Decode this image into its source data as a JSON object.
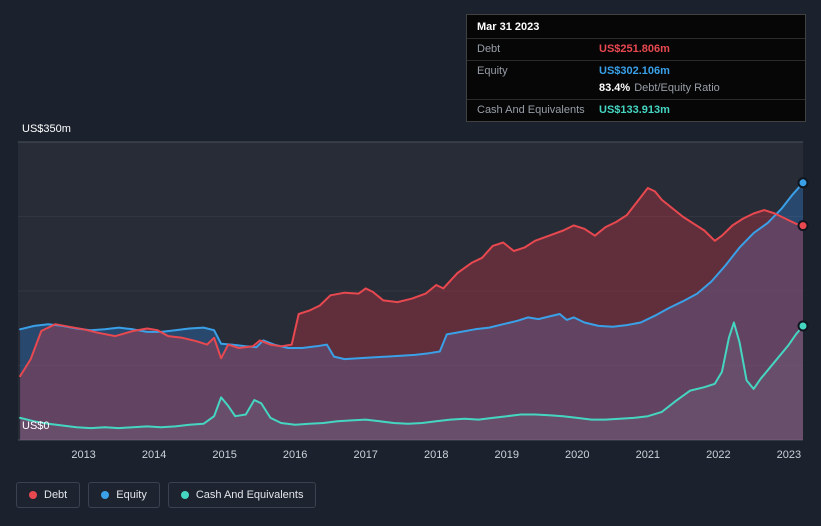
{
  "page": {
    "background": "#1b222d",
    "plot_background": "#272c36"
  },
  "y_axis": {
    "top_label": "US$350m",
    "bottom_label": "US$0"
  },
  "tooltip": {
    "date": "Mar 31 2023",
    "rows": [
      {
        "label": "Debt",
        "value": "US$251.806m",
        "color": "#e8484f"
      },
      {
        "label": "Equity",
        "value": "US$302.106m",
        "color": "#3aa0e8"
      },
      {
        "label": "Cash And Equivalents",
        "value": "US$133.913m",
        "color": "#45d6c2"
      }
    ],
    "ratio": {
      "value": "83.4%",
      "label": "Debt/Equity Ratio"
    }
  },
  "legend": {
    "items": [
      {
        "label": "Debt",
        "color": "#e8484f"
      },
      {
        "label": "Equity",
        "color": "#3aa0e8"
      },
      {
        "label": "Cash And Equivalents",
        "color": "#45d6c2"
      }
    ]
  },
  "chart_data": {
    "type": "area",
    "title": "Debt, Equity and Cash And Equivalents history (US$m)",
    "ylim": [
      0,
      350
    ],
    "x_range": [
      2012.07,
      2023.2
    ],
    "x_ticks": [
      2013,
      2014,
      2015,
      2016,
      2017,
      2018,
      2019,
      2020,
      2021,
      2022,
      2023
    ],
    "gridlines": [
      0,
      87.5,
      175,
      262.5,
      350
    ],
    "grid": "horizontal-only",
    "legend_position": "bottom-left",
    "series": [
      {
        "name": "Equity",
        "color": "#3aa0e8",
        "fill": "rgba(42,120,200,0.38)",
        "points": [
          [
            2012.1,
            130
          ],
          [
            2012.3,
            134
          ],
          [
            2012.5,
            136
          ],
          [
            2012.7,
            134
          ],
          [
            2012.9,
            131
          ],
          [
            2013.1,
            129
          ],
          [
            2013.3,
            130
          ],
          [
            2013.5,
            132
          ],
          [
            2013.7,
            130
          ],
          [
            2013.9,
            127
          ],
          [
            2014.1,
            127
          ],
          [
            2014.3,
            129
          ],
          [
            2014.5,
            131
          ],
          [
            2014.7,
            132
          ],
          [
            2014.85,
            129
          ],
          [
            2014.95,
            113
          ],
          [
            2015.1,
            112
          ],
          [
            2015.3,
            110
          ],
          [
            2015.45,
            109
          ],
          [
            2015.55,
            117
          ],
          [
            2015.7,
            112
          ],
          [
            2015.9,
            108
          ],
          [
            2016.1,
            108
          ],
          [
            2016.3,
            110
          ],
          [
            2016.45,
            112
          ],
          [
            2016.55,
            98
          ],
          [
            2016.7,
            95
          ],
          [
            2016.9,
            96
          ],
          [
            2017.1,
            97
          ],
          [
            2017.3,
            98
          ],
          [
            2017.5,
            99
          ],
          [
            2017.7,
            100
          ],
          [
            2017.9,
            102
          ],
          [
            2018.05,
            104
          ],
          [
            2018.15,
            124
          ],
          [
            2018.35,
            127
          ],
          [
            2018.55,
            130
          ],
          [
            2018.75,
            132
          ],
          [
            2018.95,
            136
          ],
          [
            2019.15,
            140
          ],
          [
            2019.3,
            144
          ],
          [
            2019.45,
            142
          ],
          [
            2019.6,
            145
          ],
          [
            2019.75,
            148
          ],
          [
            2019.85,
            141
          ],
          [
            2019.95,
            144
          ],
          [
            2020.1,
            138
          ],
          [
            2020.3,
            134
          ],
          [
            2020.5,
            133
          ],
          [
            2020.7,
            135
          ],
          [
            2020.9,
            138
          ],
          [
            2021.1,
            146
          ],
          [
            2021.3,
            155
          ],
          [
            2021.5,
            163
          ],
          [
            2021.7,
            172
          ],
          [
            2021.9,
            186
          ],
          [
            2022.1,
            205
          ],
          [
            2022.3,
            226
          ],
          [
            2022.5,
            243
          ],
          [
            2022.7,
            255
          ],
          [
            2022.9,
            272
          ],
          [
            2023.05,
            288
          ],
          [
            2023.2,
            302.1
          ]
        ]
      },
      {
        "name": "Debt",
        "color": "#e8484f",
        "fill": "rgba(222,55,70,0.32)",
        "points": [
          [
            2012.1,
            75
          ],
          [
            2012.25,
            95
          ],
          [
            2012.4,
            128
          ],
          [
            2012.6,
            136
          ],
          [
            2012.8,
            133
          ],
          [
            2013.0,
            130
          ],
          [
            2013.2,
            126
          ],
          [
            2013.45,
            122
          ],
          [
            2013.7,
            128
          ],
          [
            2013.9,
            131
          ],
          [
            2014.05,
            129
          ],
          [
            2014.2,
            122
          ],
          [
            2014.4,
            120
          ],
          [
            2014.6,
            116
          ],
          [
            2014.75,
            112
          ],
          [
            2014.85,
            120
          ],
          [
            2014.95,
            96
          ],
          [
            2015.05,
            112
          ],
          [
            2015.2,
            108
          ],
          [
            2015.4,
            110
          ],
          [
            2015.5,
            117
          ],
          [
            2015.65,
            112
          ],
          [
            2015.8,
            110
          ],
          [
            2015.95,
            112
          ],
          [
            2016.05,
            148
          ],
          [
            2016.2,
            152
          ],
          [
            2016.35,
            158
          ],
          [
            2016.5,
            170
          ],
          [
            2016.7,
            173
          ],
          [
            2016.9,
            172
          ],
          [
            2017.0,
            178
          ],
          [
            2017.1,
            174
          ],
          [
            2017.25,
            164
          ],
          [
            2017.45,
            162
          ],
          [
            2017.65,
            166
          ],
          [
            2017.85,
            172
          ],
          [
            2018.0,
            182
          ],
          [
            2018.1,
            178
          ],
          [
            2018.3,
            196
          ],
          [
            2018.5,
            208
          ],
          [
            2018.65,
            214
          ],
          [
            2018.8,
            228
          ],
          [
            2018.95,
            232
          ],
          [
            2019.1,
            222
          ],
          [
            2019.25,
            226
          ],
          [
            2019.4,
            234
          ],
          [
            2019.6,
            240
          ],
          [
            2019.8,
            246
          ],
          [
            2019.95,
            252
          ],
          [
            2020.1,
            248
          ],
          [
            2020.25,
            240
          ],
          [
            2020.4,
            250
          ],
          [
            2020.55,
            256
          ],
          [
            2020.7,
            264
          ],
          [
            2020.85,
            280
          ],
          [
            2021.0,
            296
          ],
          [
            2021.1,
            292
          ],
          [
            2021.2,
            282
          ],
          [
            2021.35,
            272
          ],
          [
            2021.5,
            262
          ],
          [
            2021.65,
            254
          ],
          [
            2021.8,
            246
          ],
          [
            2021.95,
            234
          ],
          [
            2022.05,
            240
          ],
          [
            2022.2,
            252
          ],
          [
            2022.35,
            260
          ],
          [
            2022.5,
            266
          ],
          [
            2022.65,
            270
          ],
          [
            2022.8,
            266
          ],
          [
            2022.95,
            260
          ],
          [
            2023.1,
            254
          ],
          [
            2023.2,
            251.8
          ]
        ]
      },
      {
        "name": "Cash And Equivalents",
        "color": "#45d6c2",
        "fill": "rgba(165,175,205,0.10)",
        "points": [
          [
            2012.1,
            26
          ],
          [
            2012.3,
            22
          ],
          [
            2012.5,
            19
          ],
          [
            2012.7,
            17
          ],
          [
            2012.9,
            15
          ],
          [
            2013.1,
            14
          ],
          [
            2013.3,
            15
          ],
          [
            2013.5,
            14
          ],
          [
            2013.7,
            15
          ],
          [
            2013.9,
            16
          ],
          [
            2014.1,
            15
          ],
          [
            2014.3,
            16
          ],
          [
            2014.5,
            18
          ],
          [
            2014.7,
            19
          ],
          [
            2014.85,
            28
          ],
          [
            2014.95,
            50
          ],
          [
            2015.05,
            40
          ],
          [
            2015.15,
            28
          ],
          [
            2015.3,
            30
          ],
          [
            2015.42,
            47
          ],
          [
            2015.52,
            43
          ],
          [
            2015.65,
            26
          ],
          [
            2015.8,
            20
          ],
          [
            2016.0,
            18
          ],
          [
            2016.2,
            19
          ],
          [
            2016.4,
            20
          ],
          [
            2016.6,
            22
          ],
          [
            2016.8,
            23
          ],
          [
            2017.0,
            24
          ],
          [
            2017.2,
            22
          ],
          [
            2017.4,
            20
          ],
          [
            2017.6,
            19
          ],
          [
            2017.8,
            20
          ],
          [
            2018.0,
            22
          ],
          [
            2018.2,
            24
          ],
          [
            2018.4,
            25
          ],
          [
            2018.6,
            24
          ],
          [
            2018.8,
            26
          ],
          [
            2019.0,
            28
          ],
          [
            2019.2,
            30
          ],
          [
            2019.4,
            30
          ],
          [
            2019.6,
            29
          ],
          [
            2019.8,
            28
          ],
          [
            2020.0,
            26
          ],
          [
            2020.2,
            24
          ],
          [
            2020.4,
            24
          ],
          [
            2020.6,
            25
          ],
          [
            2020.8,
            26
          ],
          [
            2021.0,
            28
          ],
          [
            2021.2,
            33
          ],
          [
            2021.4,
            46
          ],
          [
            2021.6,
            58
          ],
          [
            2021.8,
            62
          ],
          [
            2021.95,
            66
          ],
          [
            2022.05,
            80
          ],
          [
            2022.15,
            120
          ],
          [
            2022.22,
            138
          ],
          [
            2022.3,
            115
          ],
          [
            2022.4,
            70
          ],
          [
            2022.5,
            60
          ],
          [
            2022.6,
            72
          ],
          [
            2022.8,
            92
          ],
          [
            2023.0,
            112
          ],
          [
            2023.1,
            124
          ],
          [
            2023.2,
            133.9
          ]
        ]
      }
    ]
  }
}
